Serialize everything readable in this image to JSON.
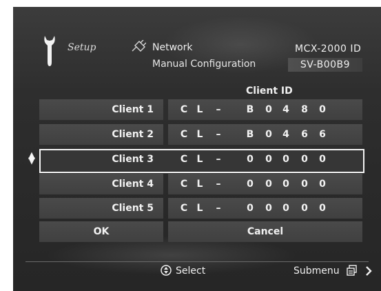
{
  "header": {
    "setup_label": "Setup",
    "network_label": "Network",
    "subtitle": "Manual Configuration",
    "model_label": "MCX-2000 ID",
    "device_id": "SV-B00B9"
  },
  "table": {
    "column_title": "Client ID",
    "rows": [
      {
        "label": "Client 1",
        "chars": [
          "C",
          "L",
          "–",
          "B",
          "0",
          "4",
          "8",
          "0"
        ]
      },
      {
        "label": "Client 2",
        "chars": [
          "C",
          "L",
          "–",
          "B",
          "0",
          "4",
          "6",
          "6"
        ]
      },
      {
        "label": "Client 3",
        "chars": [
          "C",
          "L",
          "–",
          "0",
          "0",
          "0",
          "0",
          "0"
        ]
      },
      {
        "label": "Client 4",
        "chars": [
          "C",
          "L",
          "–",
          "0",
          "0",
          "0",
          "0",
          "0"
        ]
      },
      {
        "label": "Client 5",
        "chars": [
          "C",
          "L",
          "–",
          "0",
          "0",
          "0",
          "0",
          "0"
        ]
      }
    ],
    "selected_row": "Client 3"
  },
  "buttons": {
    "ok": "OK",
    "cancel": "Cancel"
  },
  "footer": {
    "select_hint": "Select",
    "submenu_hint": "Submenu"
  },
  "icons": {
    "setup": "wrench-icon",
    "network": "network-plug-icon",
    "selector": "up-down-arrow-icon",
    "select": "dpad-icon",
    "submenu": "submenu-icon"
  },
  "colors": {
    "background": "#2e2e2e",
    "row": "#454545",
    "text": "#f2f2f2",
    "highlight": "#f4f4f4"
  }
}
